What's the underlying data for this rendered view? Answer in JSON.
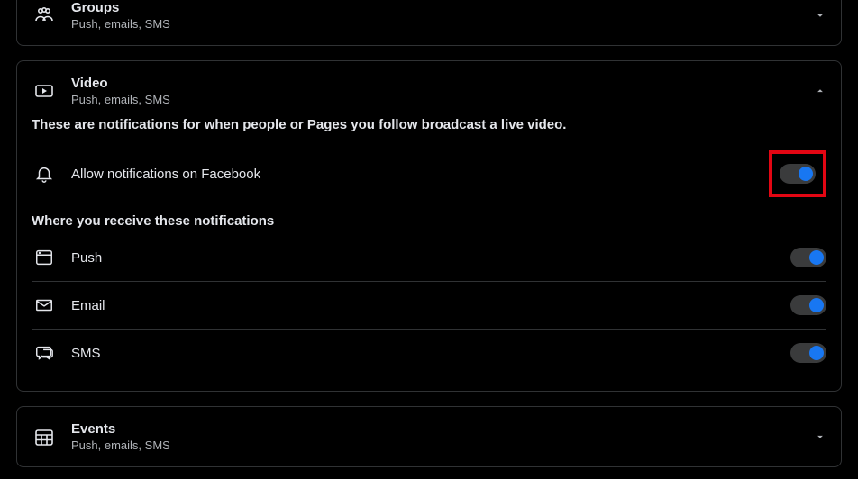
{
  "sections": {
    "groups": {
      "title": "Groups",
      "subtitle": "Push, emails, SMS"
    },
    "video": {
      "title": "Video",
      "subtitle": "Push, emails, SMS",
      "description": "These are notifications for when people or Pages you follow broadcast a live video.",
      "allow_label": "Allow notifications on Facebook",
      "allow_on": true,
      "where_header": "Where you receive these notifications",
      "channels": {
        "push": {
          "label": "Push",
          "on": true
        },
        "email": {
          "label": "Email",
          "on": true
        },
        "sms": {
          "label": "SMS",
          "on": true
        }
      }
    },
    "events": {
      "title": "Events",
      "subtitle": "Push, emails, SMS"
    }
  }
}
